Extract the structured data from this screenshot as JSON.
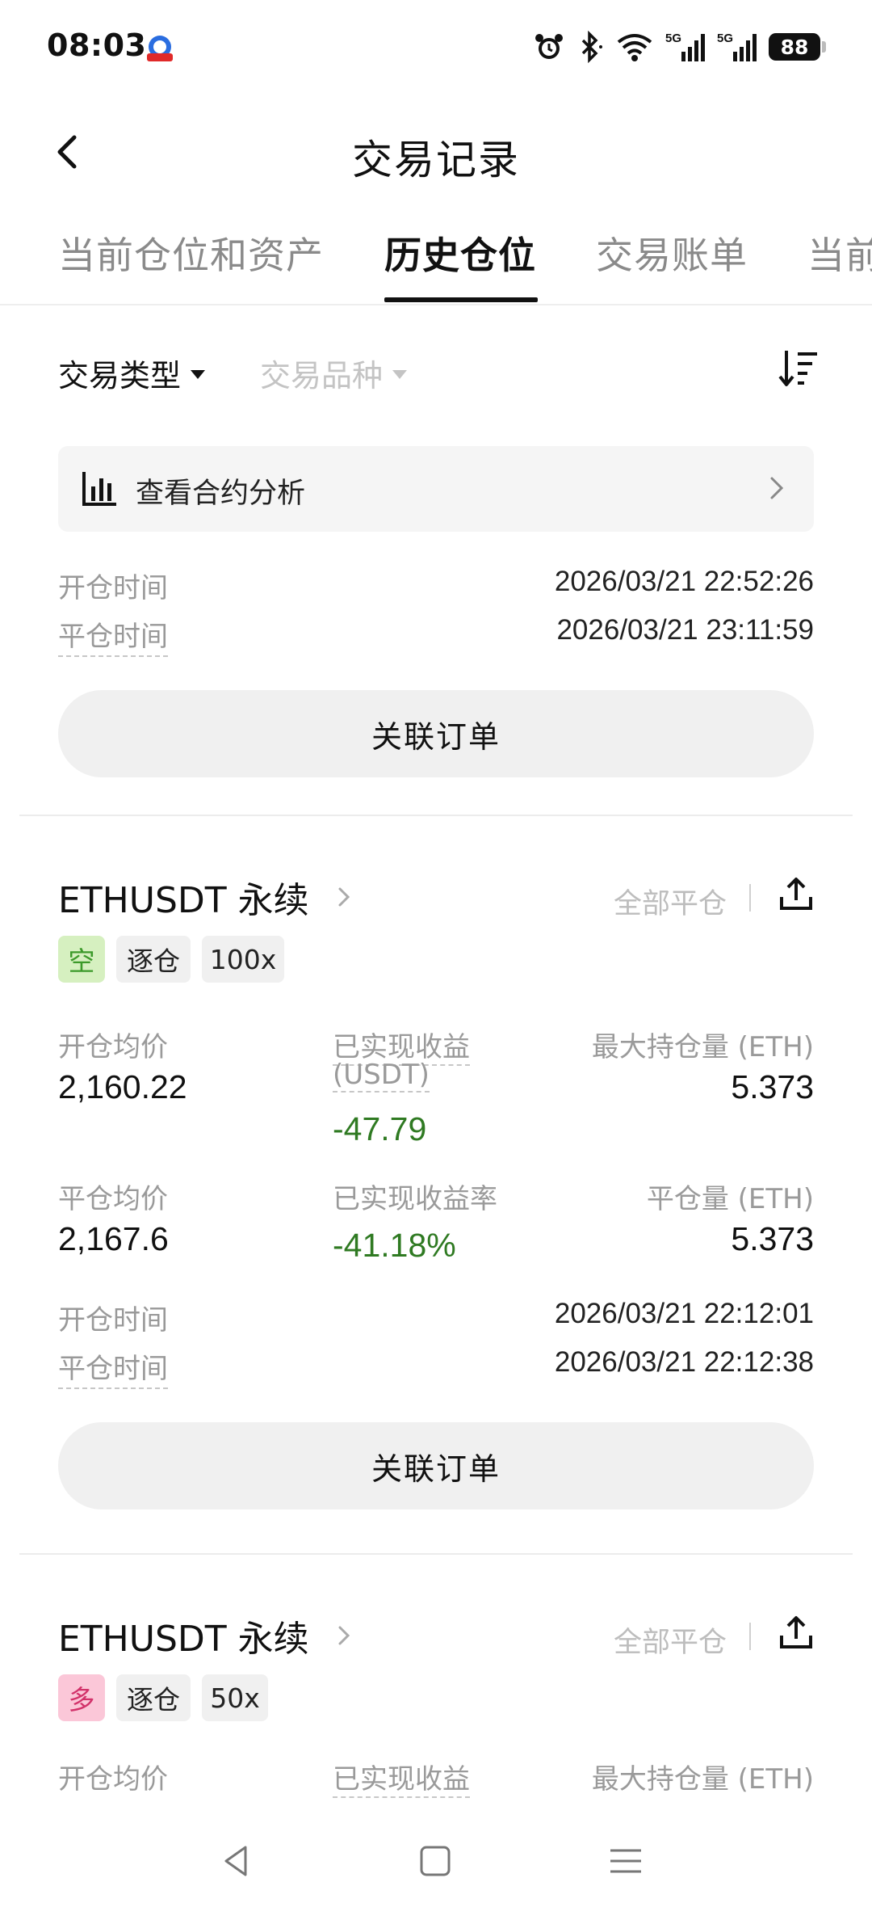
{
  "status_bar": {
    "time": "08:03",
    "battery": "88",
    "network_1": "5G",
    "network_2": "5G"
  },
  "header": {
    "title": "交易记录"
  },
  "tabs": [
    {
      "label": "当前仓位和资产",
      "active": false
    },
    {
      "label": "历史仓位",
      "active": true
    },
    {
      "label": "交易账单",
      "active": false
    },
    {
      "label": "当前",
      "active": false
    }
  ],
  "filters": {
    "type_label": "交易类型",
    "symbol_label": "交易品种"
  },
  "analysis": {
    "label": "查看合约分析"
  },
  "prev_card": {
    "open_time_label": "开仓时间",
    "open_time": "2026/03/21 22:52:26",
    "close_time_label": "平仓时间",
    "close_time": "2026/03/21 23:11:59",
    "related_orders": "关联订单"
  },
  "position_1": {
    "symbol": "ETHUSDT 永续",
    "close_all": "全部平仓",
    "side": "空",
    "margin_mode": "逐仓",
    "leverage": "100x",
    "avg_open_label": "开仓均价",
    "avg_open": "2,160.22",
    "realized_pnl_label": "已实现收益",
    "realized_pnl_unit": "(USDT)",
    "realized_pnl": "-47.79",
    "max_position_label": "最大持仓量 (ETH)",
    "max_position": "5.373",
    "avg_close_label": "平仓均价",
    "avg_close": "2,167.6",
    "realized_rate_label": "已实现收益率",
    "realized_rate": "-41.18%",
    "closed_qty_label": "平仓量 (ETH)",
    "closed_qty": "5.373",
    "open_time_label": "开仓时间",
    "open_time": "2026/03/21 22:12:01",
    "close_time_label": "平仓时间",
    "close_time": "2026/03/21 22:12:38",
    "related_orders": "关联订单"
  },
  "position_2": {
    "symbol": "ETHUSDT 永续",
    "close_all": "全部平仓",
    "side": "多",
    "margin_mode": "逐仓",
    "leverage": "50x",
    "avg_open_label": "开仓均价",
    "realized_pnl_label": "已实现收益",
    "max_position_label": "最大持仓量 (ETH)"
  },
  "colors": {
    "loss_green": "#2f7a22",
    "short_tag_bg": "#d6f0c0",
    "long_tag_bg": "#fbc7d8"
  }
}
